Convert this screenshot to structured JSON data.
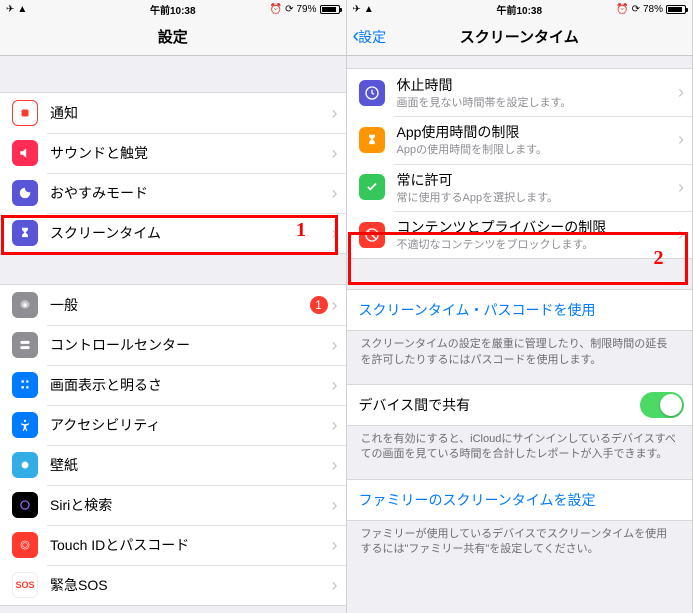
{
  "left": {
    "status_time": "午前10:38",
    "status_batt": "79%",
    "nav_title": "設定",
    "items": [
      {
        "title": "通知"
      },
      {
        "title": "サウンドと触覚"
      },
      {
        "title": "おやすみモード"
      },
      {
        "title": "スクリーンタイム"
      }
    ],
    "items2": [
      {
        "title": "一般",
        "badge": "1"
      },
      {
        "title": "コントロールセンター"
      },
      {
        "title": "画面表示と明るさ"
      },
      {
        "title": "アクセシビリティ"
      },
      {
        "title": "壁紙"
      },
      {
        "title": "Siriと検索"
      },
      {
        "title": "Touch IDとパスコード"
      },
      {
        "title": "緊急SOS"
      }
    ],
    "annot": "1"
  },
  "right": {
    "status_time": "午前10:38",
    "status_batt": "78%",
    "back_label": "設定",
    "nav_title": "スクリーンタイム",
    "items": [
      {
        "title": "休止時間",
        "sub": "画面を見ない時間帯を設定します。"
      },
      {
        "title": "App使用時間の制限",
        "sub": "Appの使用時間を制限します。"
      },
      {
        "title": "常に許可",
        "sub": "常に使用するAppを選択します。"
      },
      {
        "title": "コンテンツとプライバシーの制限",
        "sub": "不適切なコンテンツをブロックします。"
      }
    ],
    "passcode_link": "スクリーンタイム・パスコードを使用",
    "passcode_foot": "スクリーンタイムの設定を厳重に管理したり、制限時間の延長を許可したりするにはパスコードを使用します。",
    "share_title": "デバイス間で共有",
    "share_foot": "これを有効にすると、iCloudにサインインしているデバイスすべての画面を見ている時間を合計したレポートが入手できます。",
    "family_link": "ファミリーのスクリーンタイムを設定",
    "family_foot": "ファミリーが使用しているデバイスでスクリーンタイムを使用するには\"ファミリー共有\"を設定してください。",
    "annot": "2"
  }
}
